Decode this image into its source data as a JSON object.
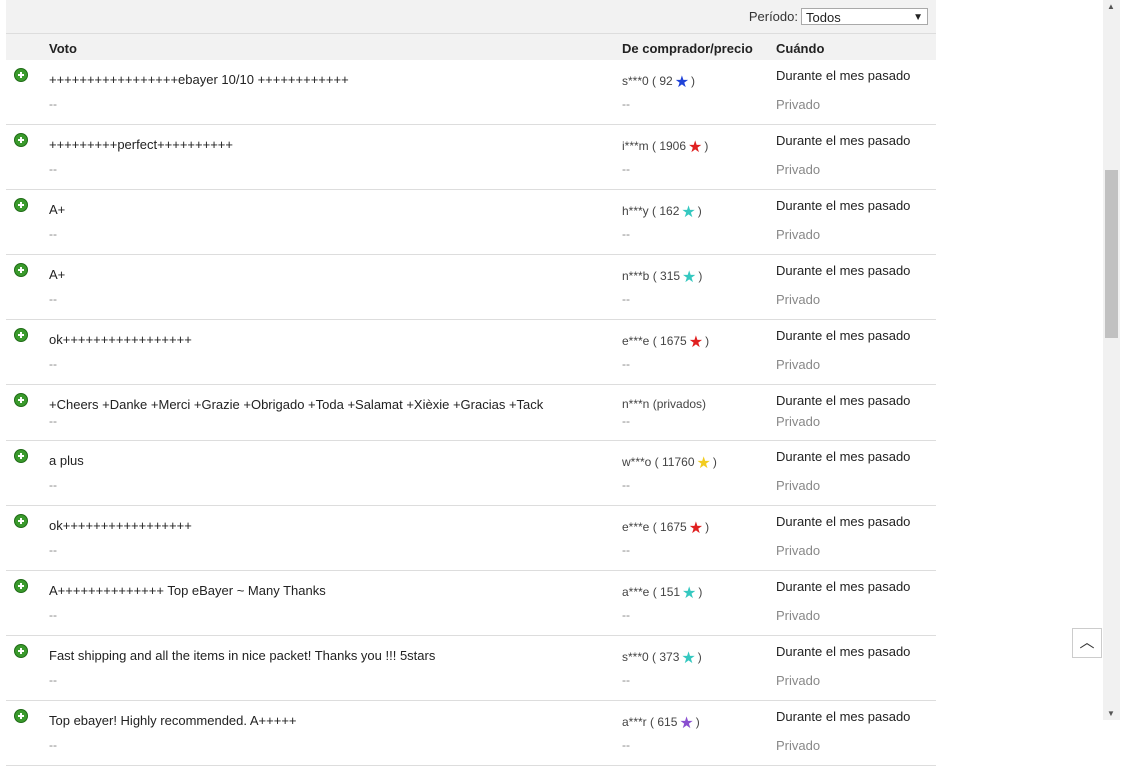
{
  "filter": {
    "label": "Período:",
    "value": "Todos"
  },
  "columns": {
    "vote": "Voto",
    "buyer": "De comprador/precio",
    "when": "Cuándo"
  },
  "rows": [
    {
      "comment": "+++++++++++++++++ebayer 10/10 ++++++++++++",
      "dash": "--",
      "buyer": "s***0 ( 92",
      "buyer_close": ")",
      "star_color": "#2043d8",
      "when": "Durante el mes pasado",
      "privacy": "Privado",
      "dash2": "--"
    },
    {
      "comment": "+++++++++perfect++++++++++",
      "dash": "--",
      "buyer": "i***m ( 1906",
      "buyer_close": ")",
      "star_color": "#e02020",
      "when": "Durante el mes pasado",
      "privacy": "Privado",
      "dash2": "--"
    },
    {
      "comment": "A+",
      "dash": "--",
      "buyer": "h***y ( 162",
      "buyer_close": ")",
      "star_color": "#35c8c0",
      "when": "Durante el mes pasado",
      "privacy": "Privado",
      "dash2": "--"
    },
    {
      "comment": "A+",
      "dash": "--",
      "buyer": "n***b ( 315",
      "buyer_close": ")",
      "star_color": "#35c8c0",
      "when": "Durante el mes pasado",
      "privacy": "Privado",
      "dash2": "--"
    },
    {
      "comment": "ok+++++++++++++++++",
      "dash": "--",
      "buyer": "e***e ( 1675",
      "buyer_close": ")",
      "star_color": "#e02020",
      "when": "Durante el mes pasado",
      "privacy": "Privado",
      "dash2": "--"
    },
    {
      "comment": "+Cheers +Danke +Merci +Grazie +Obrigado +Toda +Salamat +Xièxie +Gracias +Tack",
      "dash": "--",
      "buyer": "n***n (privados)",
      "buyer_close": "",
      "star_color": "",
      "when": "Durante el mes pasado",
      "privacy": "Privado",
      "dash2": "--"
    },
    {
      "comment": "a plus",
      "dash": "--",
      "buyer": "w***o ( 11760",
      "buyer_close": ")",
      "star_color": "#f2cc1e",
      "when": "Durante el mes pasado",
      "privacy": "Privado",
      "dash2": "--"
    },
    {
      "comment": "ok+++++++++++++++++",
      "dash": "--",
      "buyer": "e***e ( 1675",
      "buyer_close": ")",
      "star_color": "#e02020",
      "when": "Durante el mes pasado",
      "privacy": "Privado",
      "dash2": "--"
    },
    {
      "comment": "A++++++++++++++ Top eBayer ~ Many Thanks",
      "dash": "--",
      "buyer": "a***e ( 151",
      "buyer_close": ")",
      "star_color": "#35c8c0",
      "when": "Durante el mes pasado",
      "privacy": "Privado",
      "dash2": "--"
    },
    {
      "comment": "Fast shipping and all the items in nice packet! Thanks you !!! 5stars",
      "dash": "--",
      "buyer": "s***0 ( 373",
      "buyer_close": ")",
      "star_color": "#35c8c0",
      "when": "Durante el mes pasado",
      "privacy": "Privado",
      "dash2": "--"
    },
    {
      "comment": "Top ebayer! Highly recommended. A+++++",
      "dash": "--",
      "buyer": "a***r ( 615",
      "buyer_close": ")",
      "star_color": "#8a4fd0",
      "when": "Durante el mes pasado",
      "privacy": "Privado",
      "dash2": "--"
    }
  ],
  "icons": {
    "vote": "positive-feedback-icon",
    "buyer_star": "feedback-star-icon",
    "back_to_top": "chevron-up-icon"
  }
}
